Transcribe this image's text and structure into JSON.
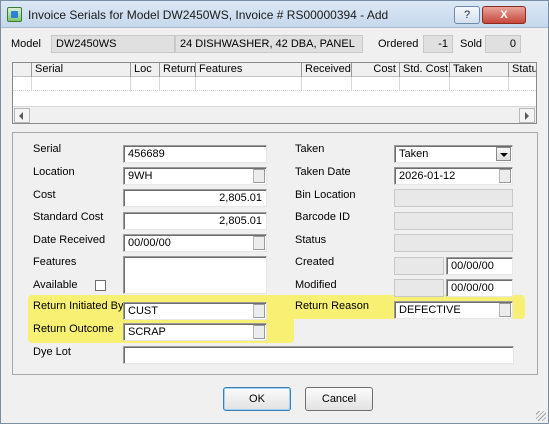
{
  "window": {
    "title": "Invoice Serials for Model DW2450WS, Invoice # RS00000394 - Add",
    "help_glyph": "?",
    "close_glyph": "X"
  },
  "header": {
    "model_label": "Model",
    "model_value": "DW2450WS",
    "description_value": "24 DISHWASHER, 42 DBA, PANEL",
    "ordered_label": "Ordered",
    "ordered_value": "-1",
    "sold_label": "Sold",
    "sold_value": "0"
  },
  "grid": {
    "columns": [
      "Serial",
      "Loc",
      "Return",
      "Features",
      "Received",
      "Cost",
      "Std. Cost",
      "Taken",
      "Status"
    ],
    "rows": []
  },
  "form": {
    "serial": {
      "label": "Serial",
      "value": "456689"
    },
    "location": {
      "label": "Location",
      "value": "9WH"
    },
    "cost": {
      "label": "Cost",
      "value": "2,805.01"
    },
    "standard_cost": {
      "label": "Standard Cost",
      "value": "2,805.01"
    },
    "date_received": {
      "label": "Date Received",
      "value": "00/00/00"
    },
    "features": {
      "label": "Features",
      "value": ""
    },
    "available": {
      "label": "Available",
      "checked": false
    },
    "return_initiated_by": {
      "label": "Return Initiated By",
      "value": "CUST"
    },
    "return_outcome": {
      "label": "Return Outcome",
      "value": "SCRAP"
    },
    "dye_lot": {
      "label": "Dye Lot",
      "value": ""
    },
    "taken": {
      "label": "Taken",
      "value": "Taken"
    },
    "taken_date": {
      "label": "Taken Date",
      "value": "2026-01-12"
    },
    "bin_location": {
      "label": "Bin Location",
      "value": ""
    },
    "barcode_id": {
      "label": "Barcode ID",
      "value": ""
    },
    "status": {
      "label": "Status",
      "value": ""
    },
    "created": {
      "label": "Created",
      "value": "",
      "date": "00/00/00"
    },
    "modified": {
      "label": "Modified",
      "value": "",
      "date": "00/00/00"
    },
    "return_reason": {
      "label": "Return Reason",
      "value": "DEFECTIVE"
    }
  },
  "buttons": {
    "ok": "OK",
    "cancel": "Cancel"
  },
  "colors": {
    "highlight": "#f8f073",
    "titlebar": "#c6d8ec",
    "close_button": "#c6473a"
  }
}
